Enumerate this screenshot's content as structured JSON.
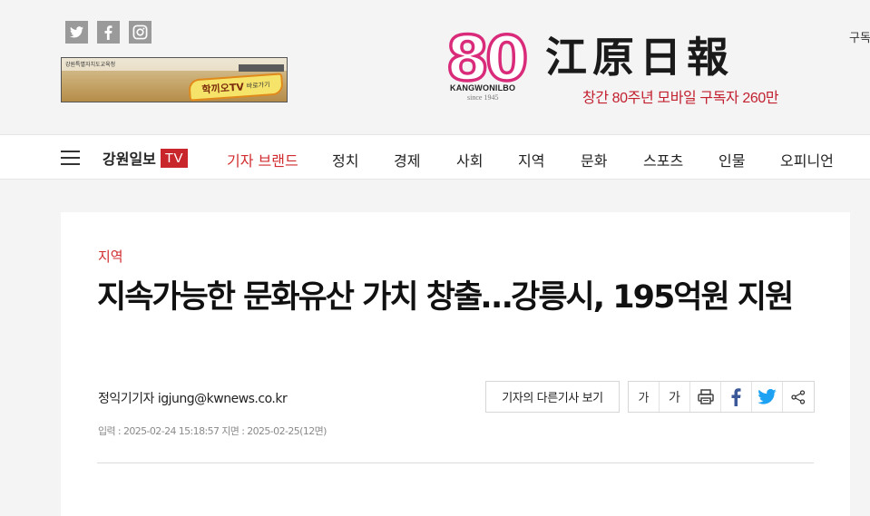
{
  "header": {
    "social": [
      {
        "name": "twitter-icon"
      },
      {
        "name": "facebook-icon"
      },
      {
        "name": "instagram-icon"
      }
    ],
    "banner": {
      "org_text": "강원특별자치도교육청",
      "title": "학끼오TV",
      "subtitle": "바로가기"
    },
    "logo": {
      "anniversary": "80",
      "brand_latin": "KANGWONILBO",
      "since": "since 1945",
      "name_hanja": "江原日報",
      "tagline": "창간 80주년 모바일 구독자 260만",
      "accent_color": "#d92b7a"
    },
    "subscribe_label": "구독"
  },
  "nav": {
    "brand_name": "강원일보",
    "brand_tv": "TV",
    "items": [
      "기자 브랜드",
      "정치",
      "경제",
      "사회",
      "지역",
      "문화",
      "스포츠",
      "인물",
      "오피니언"
    ],
    "highlight_color": "#d12c2f"
  },
  "article": {
    "section": "지역",
    "headline": "지속가능한 문화유산 가치 창출…강릉시, 195억원 지원",
    "byline": "정익기기자 igjung@kwnews.co.kr",
    "dates": "입력 : 2025-02-24 15:18:57 지면 : 2025-02-25(12면)",
    "other_articles_label": "기자의 다른기사 보기",
    "tools": {
      "font_smaller": "가",
      "font_larger": "가"
    }
  }
}
